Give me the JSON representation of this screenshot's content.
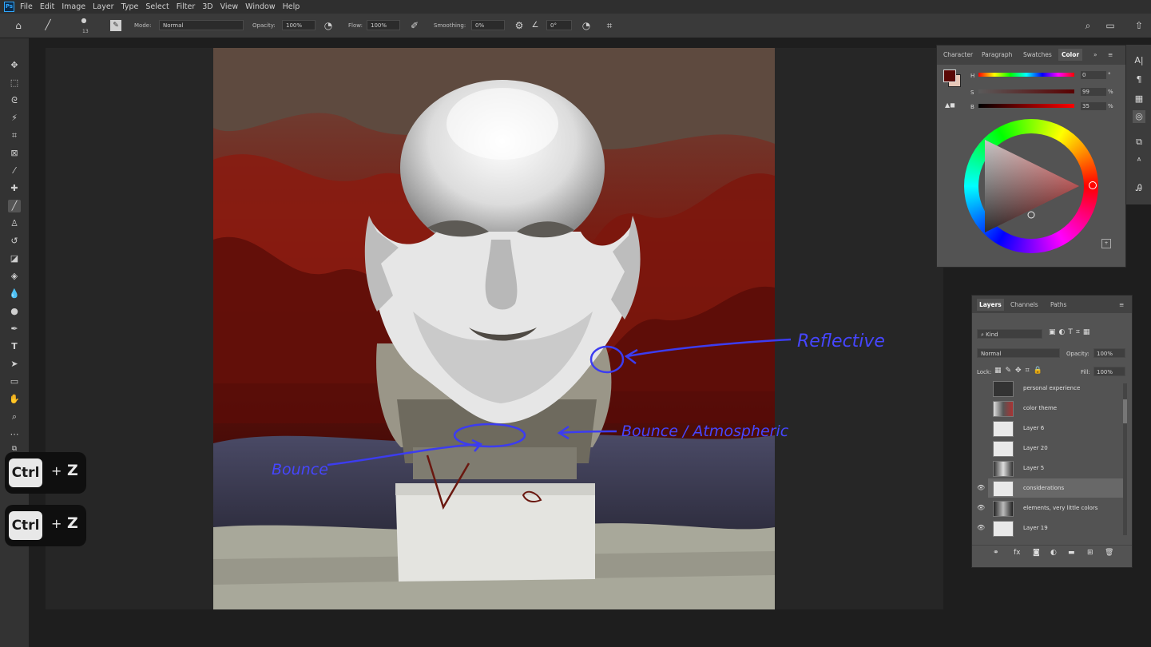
{
  "app": {
    "logo": "Ps"
  },
  "menu": [
    "File",
    "Edit",
    "Image",
    "Layer",
    "Type",
    "Select",
    "Filter",
    "3D",
    "View",
    "Window",
    "Help"
  ],
  "options": {
    "brush_size": "13",
    "mode_label": "Mode:",
    "mode_value": "Normal",
    "opacity_label": "Opacity:",
    "opacity_value": "100%",
    "flow_label": "Flow:",
    "flow_value": "100%",
    "smoothing_label": "Smoothing:",
    "smoothing_value": "0%",
    "angle_value": "0°"
  },
  "tools": [
    "move-tool",
    "marquee-tool",
    "lasso-tool",
    "magic-wand-tool",
    "crop-tool",
    "frame-tool",
    "eyedropper-tool",
    "healing-tool",
    "brush-tool",
    "stamp-tool",
    "history-brush-tool",
    "eraser-tool",
    "gradient-tool",
    "blur-tool",
    "dodge-tool",
    "pen-tool",
    "type-tool",
    "path-select-tool",
    "rectangle-tool",
    "hand-tool",
    "zoom-tool",
    "more-tools"
  ],
  "shortcuts": [
    {
      "key": "Ctrl",
      "plus": "+",
      "letter": "Z"
    },
    {
      "key": "Ctrl",
      "plus": "+",
      "letter": "Z"
    }
  ],
  "annotations": {
    "reflective": "Reflective",
    "bounce_atmospheric": "Bounce / Atmospheric",
    "bounce": "Bounce"
  },
  "color_panel": {
    "tabs": [
      "Character",
      "Paragraph",
      "Swatches",
      "Color"
    ],
    "active_tab": "Color",
    "sliders": [
      {
        "label": "H",
        "value": "0",
        "unit": "°"
      },
      {
        "label": "S",
        "value": "99",
        "unit": "%"
      },
      {
        "label": "B",
        "value": "35",
        "unit": "%"
      }
    ],
    "foreground": "#5a0806",
    "background": "#e8c8b8"
  },
  "layers_panel": {
    "tabs": [
      "Layers",
      "Channels",
      "Paths"
    ],
    "active_tab": "Layers",
    "filter_label": "Kind",
    "blend_mode": "Normal",
    "opacity_label": "Opacity:",
    "opacity_value": "100%",
    "lock_label": "Lock:",
    "fill_label": "Fill:",
    "fill_value": "100%",
    "layers": [
      {
        "name": "personal experience",
        "visible": false
      },
      {
        "name": "color theme",
        "visible": false
      },
      {
        "name": "Layer 6",
        "visible": false
      },
      {
        "name": "Layer 20",
        "visible": false
      },
      {
        "name": "Layer 5",
        "visible": false
      },
      {
        "name": "considerations",
        "visible": true
      },
      {
        "name": "elements, very little colors",
        "visible": true
      },
      {
        "name": "Layer 19",
        "visible": true
      }
    ]
  }
}
